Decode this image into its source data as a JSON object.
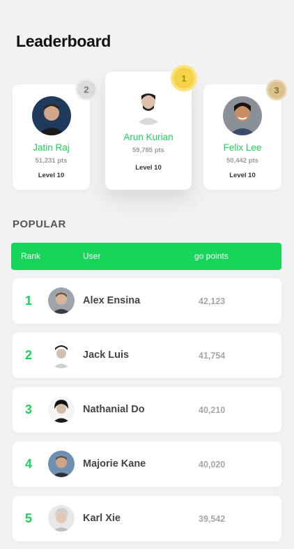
{
  "page": {
    "title": "Leaderboard"
  },
  "podium": [
    {
      "rank": "2",
      "name": "Jatin Raj",
      "points": "51,231 pts",
      "level": "Level 10"
    },
    {
      "rank": "1",
      "name": "Arun Kurian",
      "points": "59,785 pts",
      "level": "Level 10"
    },
    {
      "rank": "3",
      "name": "Felix Lee",
      "points": "50,442 pts",
      "level": "Level 10"
    }
  ],
  "popular": {
    "heading": "POPULAR",
    "columns": {
      "rank": "Rank",
      "user": "User",
      "points": "go points"
    },
    "rows": [
      {
        "rank": "1",
        "name": "Alex Ensina",
        "points": "42,123"
      },
      {
        "rank": "2",
        "name": "Jack Luis",
        "points": "41,754"
      },
      {
        "rank": "3",
        "name": "Nathanial Do",
        "points": "40,210"
      },
      {
        "rank": "4",
        "name": "Majorie Kane",
        "points": "40,020"
      },
      {
        "rank": "5",
        "name": "Karl Xie",
        "points": "39,542"
      }
    ]
  },
  "colors": {
    "accent": "#17d45a",
    "gold": "#f6d44a",
    "silver": "#dcdcdc",
    "bronze": "#d9c28d"
  }
}
